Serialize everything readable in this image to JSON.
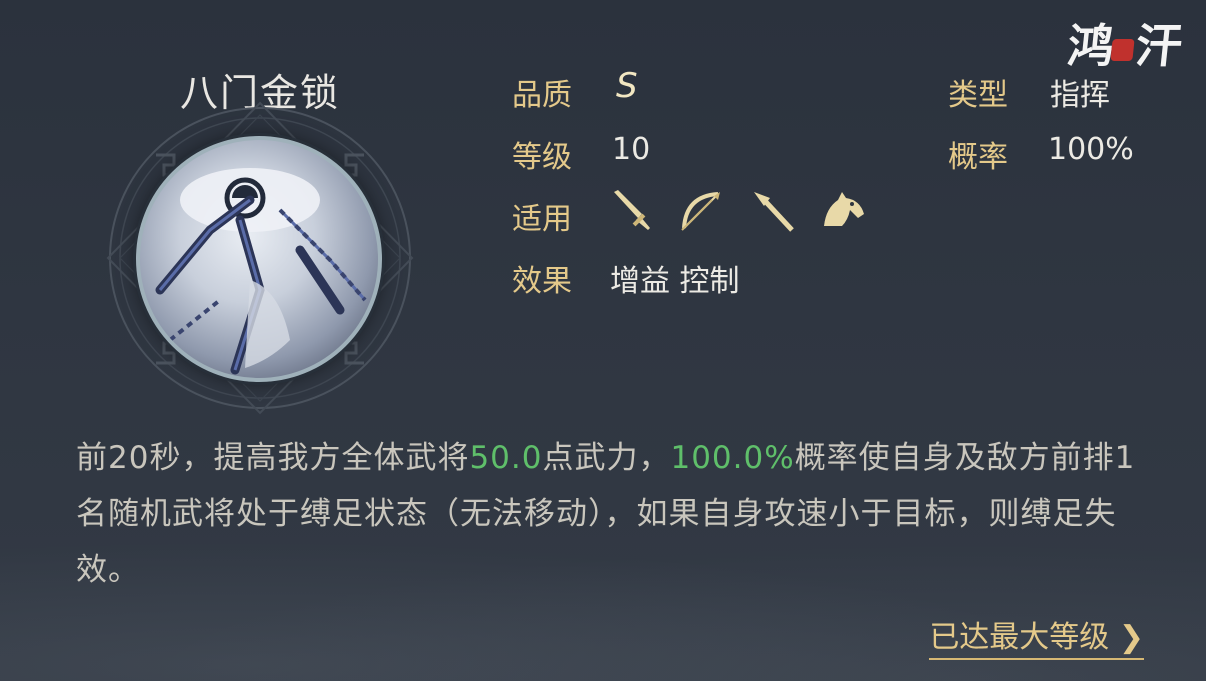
{
  "skill": {
    "name": "八门金锁",
    "labels": {
      "quality": "品质",
      "level": "等级",
      "applicable": "适用",
      "effect": "效果",
      "type": "类型",
      "chance": "概率"
    },
    "values": {
      "quality": "S",
      "level": "10",
      "type": "指挥",
      "chance": "100%",
      "effects": "增益 控制"
    },
    "applicable_units": [
      "sword-icon",
      "bow-icon",
      "spear-icon",
      "horse-icon"
    ],
    "description": {
      "p1": "前20秒，提高我方全体武将",
      "hl1": "50.0",
      "p2": "点武力，",
      "hl2": "100.0%",
      "p3": "概率使自身及敌方前排1名随机武将处于缚足状态（无法移动），如果自身攻速小于目标，则缚足失效。"
    },
    "max_level": "已达最大等级"
  },
  "logo": {
    "text_left": "鸿",
    "text_right": "汗"
  },
  "colors": {
    "label_gold": "#e4c98a",
    "highlight_green": "#5fbf6a",
    "background": "#2f3641"
  }
}
